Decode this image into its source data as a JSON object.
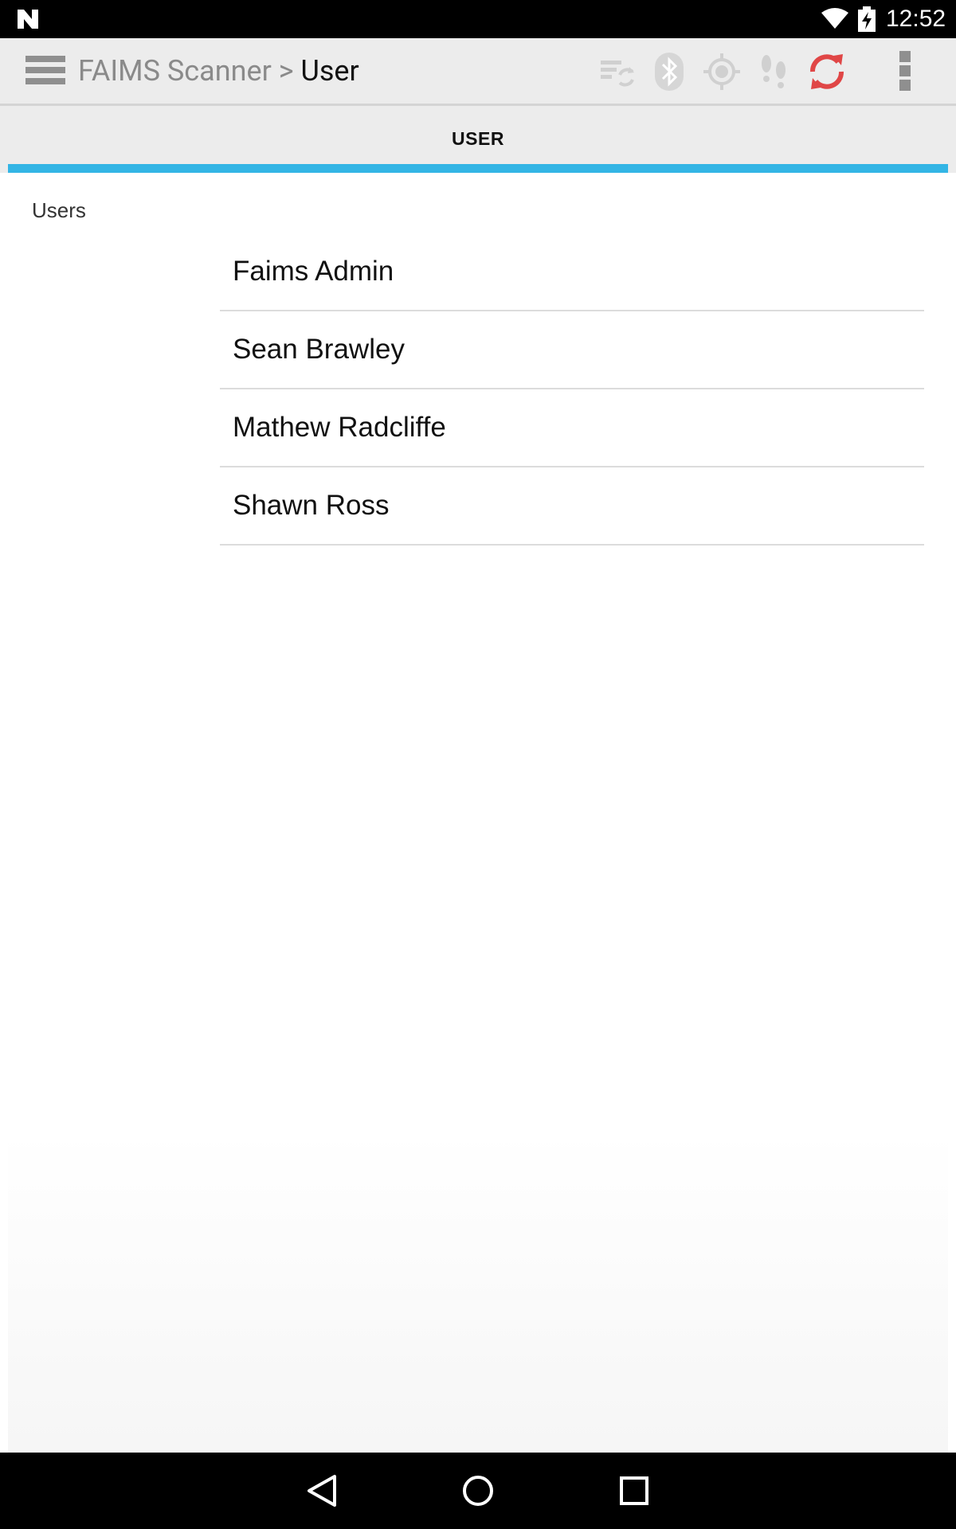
{
  "status_bar": {
    "time": "12:52",
    "icons": [
      "n-logo-icon",
      "wifi-icon",
      "battery-charging-icon"
    ]
  },
  "action_bar": {
    "app_name": "FAIMS Scanner",
    "separator": ">",
    "page_name": "User",
    "icons": [
      "menu-icon",
      "sync-status-icon",
      "bluetooth-icon",
      "gps-icon",
      "tracking-icon",
      "sync-icon",
      "overflow-menu-icon"
    ],
    "colors": {
      "inactive_icon": "#cfcfcf",
      "sync_active": "#e04646"
    }
  },
  "tabs": [
    {
      "label": "USER",
      "selected": true
    }
  ],
  "tab_indicator_color": "#33b5e5",
  "content": {
    "section_label": "Users",
    "users": [
      {
        "name": "Faims Admin"
      },
      {
        "name": "Sean Brawley"
      },
      {
        "name": "Mathew Radcliffe"
      },
      {
        "name": "Shawn Ross"
      }
    ]
  },
  "nav_bar": {
    "icons": [
      "back-icon",
      "home-icon",
      "recents-icon"
    ]
  }
}
